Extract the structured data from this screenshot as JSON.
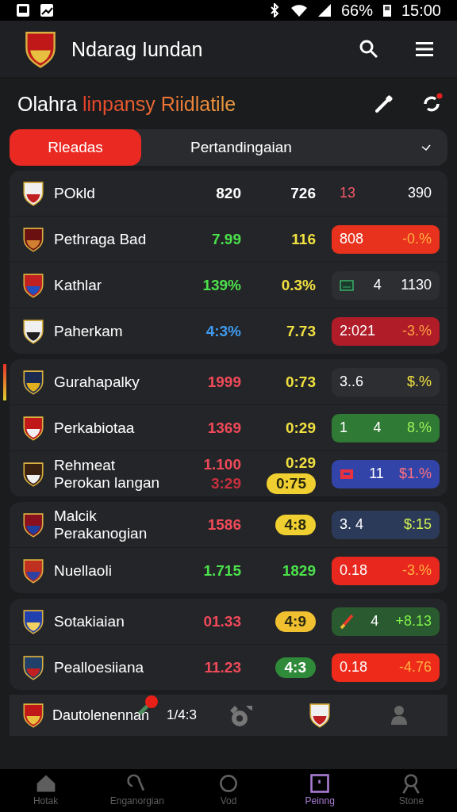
{
  "status_bar": {
    "battery": "66%",
    "time": "15:00"
  },
  "app_bar": {
    "title": "Ndarag Iundan"
  },
  "heading": {
    "lead": "Olahra",
    "accent": "linpansy Riidlatile"
  },
  "tabs": [
    {
      "label": "Rleadas",
      "selected": true
    },
    {
      "label": "Pertandingaian",
      "selected": false
    }
  ],
  "groups": [
    {
      "rows": [
        {
          "names": [
            "POkld"
          ],
          "v1": [
            {
              "text": "820",
              "color": "#ffffff"
            }
          ],
          "v2": [
            {
              "text": "726",
              "color": "#ffffff"
            }
          ],
          "chip": {
            "texts": [
              {
                "text": "13",
                "color": "#f05a6a"
              },
              {
                "text": "390",
                "color": "#ffffff"
              }
            ]
          }
        },
        {
          "names": [
            "Pethraga Bad"
          ],
          "v1": [
            {
              "text": "7.99",
              "color": "#4be04b"
            }
          ],
          "v2": [
            {
              "text": "116",
              "color": "#f0e040"
            }
          ],
          "chip": {
            "color": "#e8321e",
            "texts": [
              {
                "text": "808",
                "color": "#ffffff"
              },
              {
                "text": "-0.%",
                "color": "#ffb040"
              }
            ]
          }
        },
        {
          "names": [
            "Kathlar"
          ],
          "v1": [
            {
              "text": "139%",
              "color": "#4be04b"
            }
          ],
          "v2": [
            {
              "text": "0.3%",
              "color": "#f0e040"
            }
          ],
          "chip": {
            "color": "#2c2e31",
            "kind": "card",
            "texts": [
              {
                "text": "4",
                "color": "#ffffff"
              },
              {
                "text": "1130",
                "color": "#ffffff"
              }
            ]
          }
        },
        {
          "names": [
            "Paherkam"
          ],
          "v1": [
            {
              "text": "4:3%",
              "color": "#3e9bf0"
            }
          ],
          "v2": [
            {
              "text": "7.73",
              "color": "#f0e040"
            }
          ],
          "chip": {
            "color": "#b01c28",
            "texts": [
              {
                "text": "2:021",
                "color": "#ffffff"
              },
              {
                "text": "-3.%",
                "color": "#ffa040"
              }
            ]
          }
        }
      ]
    },
    {
      "rows": [
        {
          "accent": true,
          "names": [
            "Gurahapalky"
          ],
          "v1": [
            {
              "text": "1999",
              "color": "#f04a5a"
            }
          ],
          "v2": [
            {
              "text": "0:73",
              "color": "#f0e040"
            }
          ],
          "chip": {
            "color": "#2c2e31",
            "texts": [
              {
                "text": "3..6",
                "color": "#ffffff"
              },
              {
                "text": "$.%",
                "color": "#f0e040"
              }
            ]
          }
        },
        {
          "names": [
            "Perkabiotaa"
          ],
          "v1": [
            {
              "text": "1369",
              "color": "#f04a5a"
            }
          ],
          "v2": [
            {
              "text": "0:29",
              "color": "#f0e040"
            }
          ],
          "chip": {
            "color": "#2f7a34",
            "texts": [
              {
                "text": "1",
                "color": "#ffffff"
              },
              {
                "text": "4",
                "color": "#ffffff"
              },
              {
                "text": "8.%",
                "color": "#9ef05a"
              }
            ]
          }
        },
        {
          "names": [
            "Rehmeat",
            "Perokan langan"
          ],
          "v1": [
            {
              "text": "1.100",
              "color": "#f04a5a"
            },
            {
              "text": "3:29",
              "color": "#c8303e"
            }
          ],
          "v2": [
            {
              "text": "0:29",
              "color": "#f0e040"
            },
            {
              "text": "0:75",
              "kind": "pill",
              "color": "#f0d030"
            }
          ],
          "chip": {
            "color": "#3344a8",
            "kind": "flag",
            "texts": [
              {
                "text": "11",
                "color": "#ffffff"
              },
              {
                "text": "$1.%",
                "color": "#ff7080"
              }
            ]
          }
        }
      ]
    },
    {
      "rows": [
        {
          "names": [
            "Malcik",
            "Perakanogian"
          ],
          "v1": [
            {
              "text": "1586",
              "color": "#f04a5a"
            }
          ],
          "v2": [
            {
              "text": "4:8",
              "kind": "pill",
              "color": "#f0d030"
            }
          ],
          "chip": {
            "color": "#2c3a5a",
            "texts": [
              {
                "text": "3. 4",
                "color": "#ffffff"
              },
              {
                "text": "$:15",
                "color": "#d0f050"
              }
            ]
          }
        },
        {
          "names": [
            "Nuellaoli"
          ],
          "v1": [
            {
              "text": "1.715",
              "color": "#4be04b"
            }
          ],
          "v2": [
            {
              "text": "1829",
              "color": "#4be04b"
            }
          ],
          "chip": {
            "color": "#e8281e",
            "texts": [
              {
                "text": "0.18",
                "color": "#ffffff"
              },
              {
                "text": "-3.%",
                "color": "#ffb040"
              }
            ]
          }
        }
      ]
    },
    {
      "rows": [
        {
          "names": [
            "Sotakiaian"
          ],
          "v1": [
            {
              "text": "01.33",
              "color": "#f04a5a"
            }
          ],
          "v2": [
            {
              "text": "4:9",
              "kind": "pill",
              "color": "#f0c030"
            }
          ],
          "chip": {
            "color": "#2a5a30",
            "kind": "brush",
            "texts": [
              {
                "text": "4",
                "color": "#ffffff"
              },
              {
                "text": "+8.13",
                "color": "#7ef04a"
              }
            ]
          }
        },
        {
          "names": [
            "Pealloesiiana"
          ],
          "v1": [
            {
              "text": "11.23",
              "color": "#f04a5a"
            }
          ],
          "v2": [
            {
              "text": "4:3",
              "kind": "pill",
              "color": "#2f8a3a"
            }
          ],
          "chip": {
            "color": "#ee2a1a",
            "texts": [
              {
                "text": "0.18",
                "color": "#ffffff"
              },
              {
                "text": "-4.76",
                "color": "#ffb040"
              }
            ]
          }
        }
      ]
    }
  ],
  "mini_bar": {
    "name": "Dautolenennan",
    "value": "1/4:3"
  },
  "nav": [
    {
      "label": "Hotak",
      "selected": false
    },
    {
      "label": "Enganorgian",
      "selected": false
    },
    {
      "label": "Vod",
      "selected": false
    },
    {
      "label": "Peinng",
      "selected": true
    },
    {
      "label": "Stone",
      "selected": false
    }
  ]
}
